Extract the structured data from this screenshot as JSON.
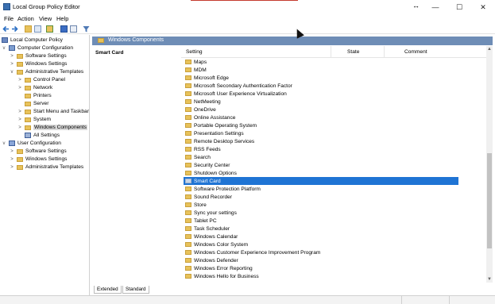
{
  "window": {
    "title": "Local Group Policy Editor",
    "resize_glyph": "↔",
    "controls": {
      "minimize": "—",
      "maximize": "☐",
      "close": "✕"
    }
  },
  "menu": [
    "File",
    "Action",
    "View",
    "Help"
  ],
  "toolbar": {
    "icons": [
      "back-icon",
      "forward-icon",
      "up-folder-icon",
      "show-hide-tree-icon",
      "export-icon",
      "help-icon",
      "properties-icon",
      "filter-icon"
    ]
  },
  "tree": [
    {
      "label": "Local Computer Policy",
      "level": 0,
      "expander": "",
      "icon": "policy"
    },
    {
      "label": "Computer Configuration",
      "level": 1,
      "expander": "v",
      "icon": "computer"
    },
    {
      "label": "Software Settings",
      "level": 2,
      "expander": ">",
      "icon": "folder"
    },
    {
      "label": "Windows Settings",
      "level": 2,
      "expander": ">",
      "icon": "folder"
    },
    {
      "label": "Administrative Templates",
      "level": 2,
      "expander": "v",
      "icon": "folder"
    },
    {
      "label": "Control Panel",
      "level": 3,
      "expander": ">",
      "icon": "folder"
    },
    {
      "label": "Network",
      "level": 3,
      "expander": ">",
      "icon": "folder"
    },
    {
      "label": "Printers",
      "level": 3,
      "expander": "",
      "icon": "folder"
    },
    {
      "label": "Server",
      "level": 3,
      "expander": "",
      "icon": "folder"
    },
    {
      "label": "Start Menu and Taskbar",
      "level": 3,
      "expander": ">",
      "icon": "folder"
    },
    {
      "label": "System",
      "level": 3,
      "expander": ">",
      "icon": "folder"
    },
    {
      "label": "Windows Components",
      "level": 3,
      "expander": ">",
      "icon": "folder",
      "selected": true
    },
    {
      "label": "All Settings",
      "level": 3,
      "expander": "",
      "icon": "settings"
    },
    {
      "label": "User Configuration",
      "level": 1,
      "expander": "v",
      "icon": "user"
    },
    {
      "label": "Software Settings",
      "level": 2,
      "expander": ">",
      "icon": "folder"
    },
    {
      "label": "Windows Settings",
      "level": 2,
      "expander": ">",
      "icon": "folder"
    },
    {
      "label": "Administrative Templates",
      "level": 2,
      "expander": ">",
      "icon": "folder"
    }
  ],
  "breadcrumb": "Windows Components",
  "description_title": "Smart Card",
  "columns": {
    "setting": "Setting",
    "state": "State",
    "comment": "Comment"
  },
  "settings": [
    "Maps",
    "MDM",
    "Microsoft Edge",
    "Microsoft Secondary Authentication Factor",
    "Microsoft User Experience Virtualization",
    "NetMeeting",
    "OneDrive",
    "Online Assistance",
    "Portable Operating System",
    "Presentation Settings",
    "Remote Desktop Services",
    "RSS Feeds",
    "Search",
    "Security Center",
    "Shutdown Options",
    "Smart Card",
    "Software Protection Platform",
    "Sound Recorder",
    "Store",
    "Sync your settings",
    "Tablet PC",
    "Task Scheduler",
    "Windows Calendar",
    "Windows Color System",
    "Windows Customer Experience Improvement Program",
    "Windows Defender",
    "Windows Error Reporting",
    "Windows Hello for Business"
  ],
  "selected_setting": "Smart Card",
  "tabs": [
    "Extended",
    "Standard"
  ],
  "colors": {
    "selection": "#1f74d4",
    "breadcrumb": "#6e8db6",
    "folder": "#e8c25a"
  }
}
